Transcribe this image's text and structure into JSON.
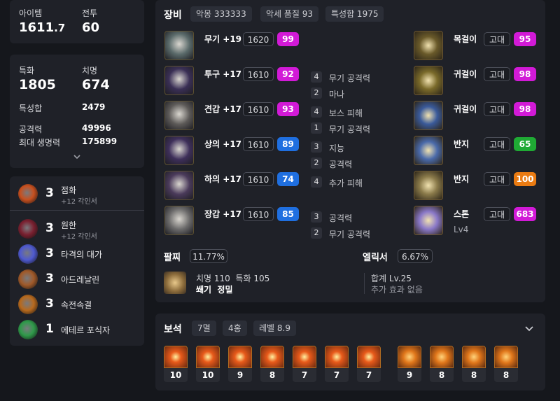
{
  "top_stats": {
    "item_level_label": "아이템",
    "item_level_main": "1611",
    "item_level_decimal": ".7",
    "battle_level_label": "전투",
    "battle_level_value": "60"
  },
  "stats": {
    "specialization_label": "특화",
    "specialization_value": "1805",
    "crit_label": "치명",
    "crit_value": "674",
    "trait_sum_label": "특성합",
    "trait_sum_value": "2479",
    "attack_label": "공격력",
    "attack_value": "49996",
    "max_hp_label": "최대 생명력",
    "max_hp_value": "175899",
    "expand_icon": "chevron-down"
  },
  "engravings": [
    {
      "level": "3",
      "name": "점화",
      "sub": "+12 각인서",
      "color": "#c8501f"
    },
    {
      "level": "3",
      "name": "원한",
      "sub": "+12 각인서",
      "color": "#7a2030"
    },
    {
      "level": "3",
      "name": "타격의 대가",
      "sub": "",
      "color": "#4f5ad0"
    },
    {
      "level": "3",
      "name": "아드레날린",
      "sub": "",
      "color": "#a05a2a"
    },
    {
      "level": "3",
      "name": "속전속결",
      "sub": "",
      "color": "#b86a1e"
    },
    {
      "level": "1",
      "name": "에테르 포식자",
      "sub": "",
      "color": "#2f9a4a"
    }
  ],
  "equipment": {
    "title": "장비",
    "tags": [
      "악몽 333333",
      "악세 품질 93",
      "특성합 1975"
    ],
    "gear": [
      {
        "name": "무기 +19",
        "ilvl": "1620",
        "quality": "99",
        "q_color": "magenta",
        "traits": []
      },
      {
        "name": "투구 +17",
        "ilvl": "1610",
        "quality": "92",
        "q_color": "magenta",
        "traits": [
          {
            "n": "4",
            "t": "무기 공격력"
          },
          {
            "n": "2",
            "t": "마나"
          }
        ]
      },
      {
        "name": "견갑 +17",
        "ilvl": "1610",
        "quality": "93",
        "q_color": "magenta",
        "traits": [
          {
            "n": "4",
            "t": "보스 피해"
          },
          {
            "n": "1",
            "t": "무기 공격력"
          }
        ]
      },
      {
        "name": "상의 +17",
        "ilvl": "1610",
        "quality": "89",
        "q_color": "blue",
        "traits": [
          {
            "n": "3",
            "t": "지능"
          },
          {
            "n": "2",
            "t": "공격력"
          }
        ]
      },
      {
        "name": "하의 +17",
        "ilvl": "1610",
        "quality": "74",
        "q_color": "blue",
        "traits": [
          {
            "n": "4",
            "t": "추가 피해"
          }
        ]
      },
      {
        "name": "장갑 +17",
        "ilvl": "1610",
        "quality": "85",
        "q_color": "blue",
        "traits": [
          {
            "n": "3",
            "t": "공격력"
          },
          {
            "n": "2",
            "t": "무기 공격력"
          }
        ]
      }
    ],
    "accessories": [
      {
        "name": "목걸이",
        "grade": "고대",
        "quality": "95",
        "q_color": "magenta",
        "sub": ""
      },
      {
        "name": "귀걸이",
        "grade": "고대",
        "quality": "98",
        "q_color": "magenta",
        "sub": ""
      },
      {
        "name": "귀걸이",
        "grade": "고대",
        "quality": "98",
        "q_color": "magenta",
        "sub": ""
      },
      {
        "name": "반지",
        "grade": "고대",
        "quality": "65",
        "q_color": "green",
        "sub": ""
      },
      {
        "name": "반지",
        "grade": "고대",
        "quality": "100",
        "q_color": "orange",
        "sub": ""
      },
      {
        "name": "스톤",
        "grade": "고대",
        "quality": "683",
        "q_color": "magenta",
        "sub": "Lv4"
      }
    ],
    "bracelet": {
      "title": "팔찌",
      "percent": "11.77%",
      "line1": "치명 110  특화 105",
      "line2": "쐐기  정밀"
    },
    "elixir": {
      "title": "엘릭서",
      "percent": "6.67%",
      "line1": "합계 Lv.25",
      "line2": "추가 효과 없음"
    }
  },
  "gems": {
    "title": "보석",
    "tags": [
      "7멸",
      "4홍",
      "레벨 8.9"
    ],
    "expand_icon": "chevron-down",
    "levels": [
      "10",
      "10",
      "9",
      "8",
      "7",
      "7",
      "7",
      "9",
      "8",
      "8",
      "8"
    ]
  }
}
